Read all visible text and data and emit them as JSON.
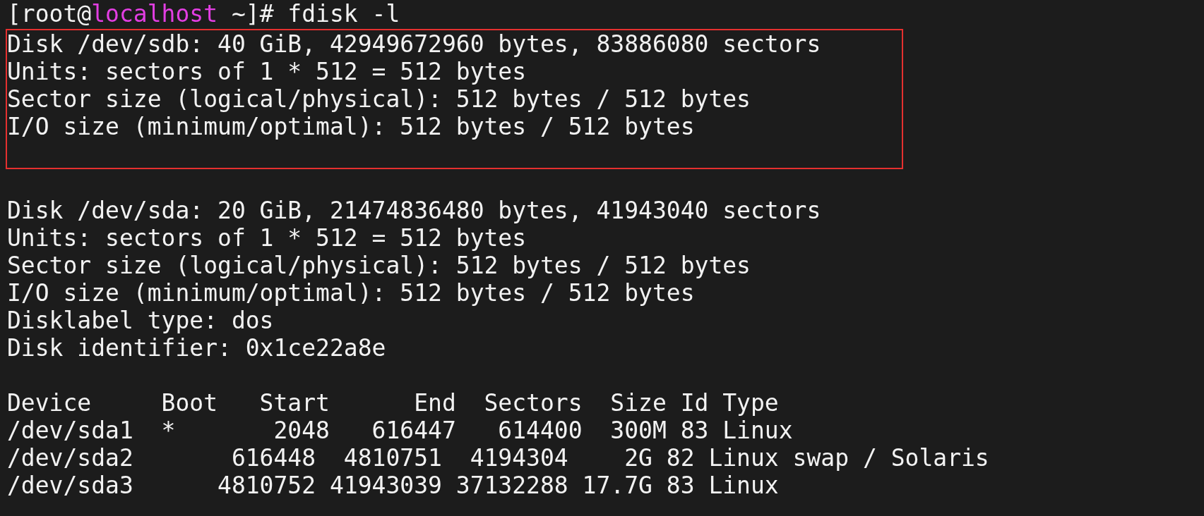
{
  "terminal": {
    "blocks": [
      {
        "highlighted": false,
        "lines": [
          {
            "kind": "prompt",
            "segments": [
              {
                "kind": "plain",
                "text": "[root@"
              },
              {
                "kind": "host",
                "text": "localhost"
              },
              {
                "kind": "plain",
                "text": " ~]# fdisk -l"
              }
            ]
          }
        ]
      },
      {
        "highlighted": true,
        "lines": [
          {
            "kind": "text",
            "text": "Disk /dev/sdb: 40 GiB, 42949672960 bytes, 83886080 sectors"
          },
          {
            "kind": "text",
            "text": "Units: sectors of 1 * 512 = 512 bytes"
          },
          {
            "kind": "text",
            "text": "Sector size (logical/physical): 512 bytes / 512 bytes"
          },
          {
            "kind": "text",
            "text": "I/O size (minimum/optimal): 512 bytes / 512 bytes"
          },
          {
            "kind": "blank"
          }
        ]
      },
      {
        "highlighted": false,
        "lines": [
          {
            "kind": "blank"
          },
          {
            "kind": "text",
            "text": "Disk /dev/sda: 20 GiB, 21474836480 bytes, 41943040 sectors"
          },
          {
            "kind": "text",
            "text": "Units: sectors of 1 * 512 = 512 bytes"
          },
          {
            "kind": "text",
            "text": "Sector size (logical/physical): 512 bytes / 512 bytes"
          },
          {
            "kind": "text",
            "text": "I/O size (minimum/optimal): 512 bytes / 512 bytes"
          },
          {
            "kind": "text",
            "text": "Disklabel type: dos"
          },
          {
            "kind": "text",
            "text": "Disk identifier: 0x1ce22a8e"
          },
          {
            "kind": "blank"
          },
          {
            "kind": "text",
            "text": "Device     Boot   Start      End  Sectors  Size Id Type"
          },
          {
            "kind": "text",
            "text": "/dev/sda1  *       2048   616447   614400  300M 83 Linux"
          },
          {
            "kind": "text",
            "text": "/dev/sda2       616448  4810751  4194304    2G 82 Linux swap / Solaris"
          },
          {
            "kind": "text",
            "text": "/dev/sda3      4810752 41943039 37132288 17.7G 83 Linux"
          }
        ]
      }
    ]
  }
}
